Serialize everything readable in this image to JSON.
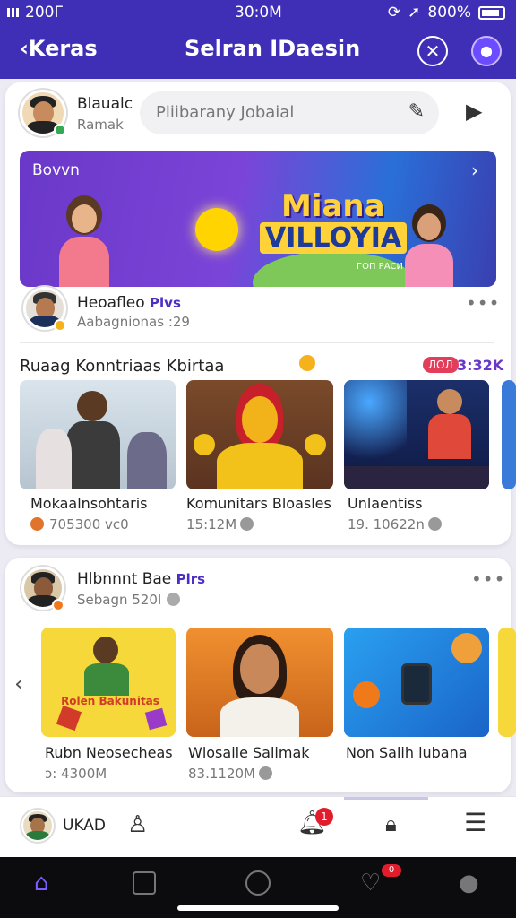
{
  "status": {
    "left": "200Г",
    "time": "30:0M",
    "right": "800%"
  },
  "header": {
    "back_label": "Keras",
    "title": "Selran IDaesin"
  },
  "composer": {
    "user_name": "Blaualc",
    "user_sub": "Ramak",
    "search_placeholder": "Pliibarany Jobaial"
  },
  "banner": {
    "label": "Bovvn",
    "title_line1": "Miana",
    "title_line2": "VILLOYIA",
    "tagline": "ГОП РАСИ"
  },
  "post1": {
    "name": "Heoafleo",
    "badge": "Plvs",
    "sub": "Aabagnionas :29"
  },
  "section1": {
    "title": "Ruaag Konntriaas Kbirtaa",
    "pill": "ЛОЛ",
    "live": "3:32K",
    "items": [
      {
        "title": "Mokaalnsohtaris",
        "meta": "705300 vc0"
      },
      {
        "title": "Komunitars Bloasles",
        "meta": "15:12M"
      },
      {
        "title": "Unlaentiss",
        "meta": "19. 10622n"
      }
    ]
  },
  "post2": {
    "name": "Hlbnnnt Bae",
    "badge": "Plrs",
    "sub": "Sebagn 520I"
  },
  "section2": {
    "items": [
      {
        "title": "Rubn Neosecheas",
        "meta": "ↄ: 4300M",
        "thumb_text": "Rolen Bakunitas"
      },
      {
        "title": "Wlosaile Salimak",
        "meta": "83.1120M"
      },
      {
        "title": "Non Salih lubana",
        "meta": ""
      }
    ]
  },
  "appbar": {
    "me_label": "UKAD",
    "notif_count": "1"
  },
  "navbar": {
    "heart_count": "0"
  }
}
